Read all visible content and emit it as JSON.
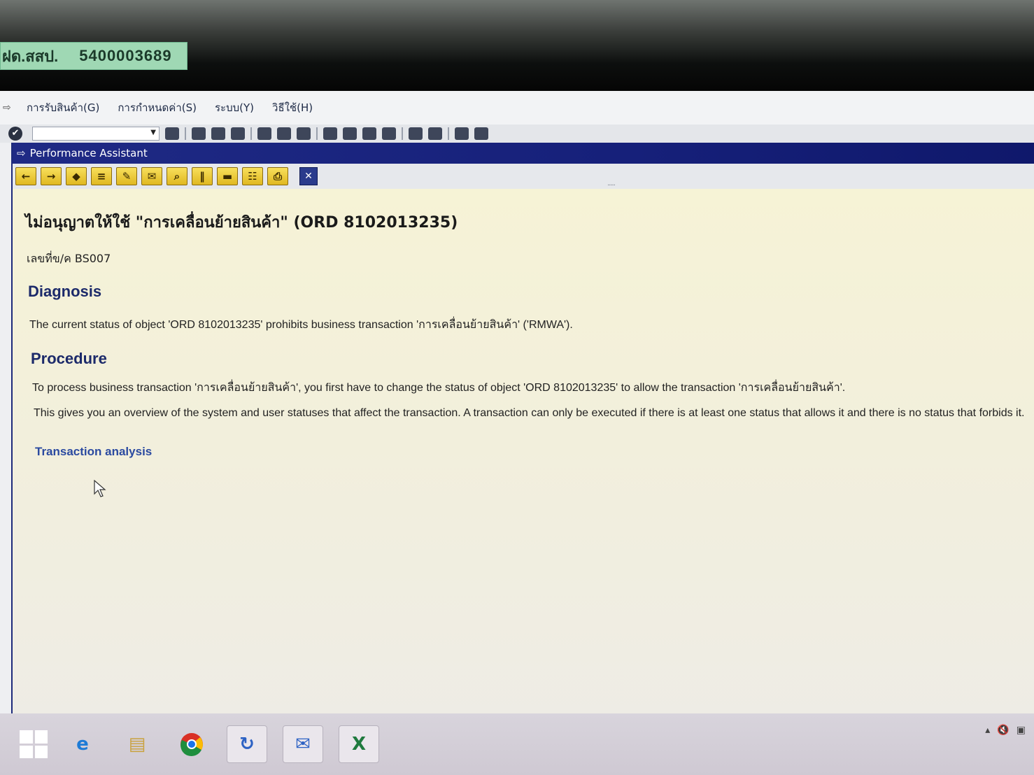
{
  "sticker": {
    "prefix": "ฝด.สสป.",
    "code": "5400003689"
  },
  "menu": {
    "items": [
      "การรับสินค้า(G)",
      "การกำหนดค่า(S)",
      "ระบบ(Y)",
      "วิธีใช้(H)"
    ]
  },
  "window": {
    "title": "Performance Assistant"
  },
  "content": {
    "heading": "ไม่อนุญาตให้ใช้ \"การเคลื่อนย้ายสินค้า\" (ORD 8102013235)",
    "doc_number": "เลขที่ข/ค BS007",
    "diagnosis": {
      "title": "Diagnosis",
      "text": "The current status of object 'ORD 8102013235' prohibits business transaction 'การเคลื่อนย้ายสินค้า' ('RMWA')."
    },
    "procedure": {
      "title": "Procedure",
      "text1": "To process business transaction 'การเคลื่อนย้ายสินค้า', you first have to change the status of object 'ORD 8102013235' to allow the transaction 'การเคลื่อนย้ายสินค้า'.",
      "text2": "This gives you an overview of the system and user statuses that affect the transaction. A transaction can only be executed if there is at least one status that allows it and there is no status that forbids it."
    },
    "link": "Transaction analysis"
  },
  "icons": {
    "toolbar_pa": [
      "back-icon",
      "forward-icon",
      "book-icon",
      "structure-icon",
      "edit-icon",
      "notes-icon",
      "find-icon",
      "columns-icon",
      "folder-icon",
      "print-preview-icon",
      "print-icon",
      "close-icon"
    ],
    "taskbar": [
      "ie-icon",
      "file-explorer-icon",
      "chrome-icon",
      "sap-logon-icon",
      "outlook-icon",
      "excel-icon"
    ]
  },
  "colors": {
    "titlebar": "#1f2a85",
    "content_bg": "#f6f3d6",
    "section_heading": "#1c2a6a",
    "link": "#2b4aa0",
    "toolbar_button": "#f0c93a"
  }
}
